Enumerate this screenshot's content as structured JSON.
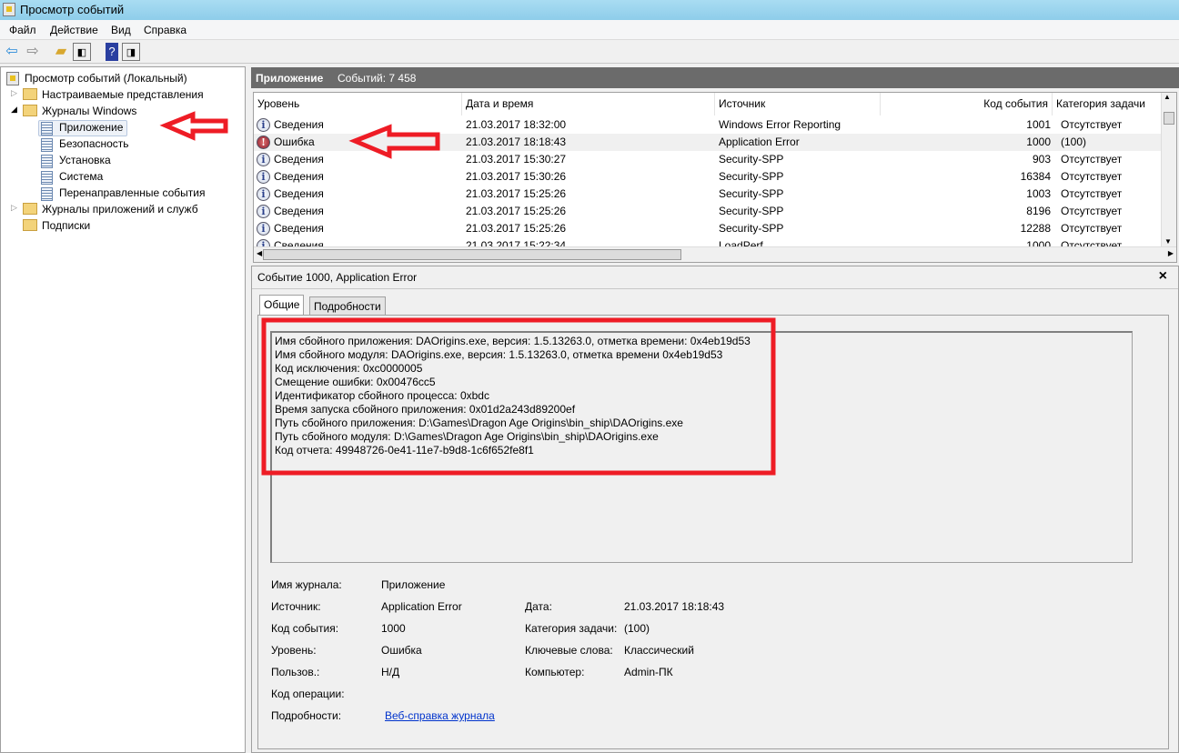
{
  "window": {
    "title": "Просмотр событий"
  },
  "menu": [
    "Файл",
    "Действие",
    "Вид",
    "Справка"
  ],
  "tree": {
    "root": "Просмотр событий (Локальный)",
    "custom_views": "Настраиваемые представления",
    "windows_logs": "Журналы Windows",
    "logs": [
      "Приложение",
      "Безопасность",
      "Установка",
      "Система",
      "Перенаправленные события"
    ],
    "app_logs": "Журналы приложений и служб",
    "subscriptions": "Подписки"
  },
  "header": {
    "title": "Приложение",
    "count": "Событий: 7 458"
  },
  "columns": [
    "Уровень",
    "Дата и время",
    "Источник",
    "Код события",
    "Категория задачи"
  ],
  "rows": [
    {
      "level": "Сведения",
      "type": "info",
      "date": "21.03.2017 18:32:00",
      "source": "Windows Error Reporting",
      "id": "1001",
      "cat": "Отсутствует"
    },
    {
      "level": "Ошибка",
      "type": "error",
      "date": "21.03.2017 18:18:43",
      "source": "Application Error",
      "id": "1000",
      "cat": "(100)"
    },
    {
      "level": "Сведения",
      "type": "info",
      "date": "21.03.2017 15:30:27",
      "source": "Security-SPP",
      "id": "903",
      "cat": "Отсутствует"
    },
    {
      "level": "Сведения",
      "type": "info",
      "date": "21.03.2017 15:30:26",
      "source": "Security-SPP",
      "id": "16384",
      "cat": "Отсутствует"
    },
    {
      "level": "Сведения",
      "type": "info",
      "date": "21.03.2017 15:25:26",
      "source": "Security-SPP",
      "id": "1003",
      "cat": "Отсутствует"
    },
    {
      "level": "Сведения",
      "type": "info",
      "date": "21.03.2017 15:25:26",
      "source": "Security-SPP",
      "id": "8196",
      "cat": "Отсутствует"
    },
    {
      "level": "Сведения",
      "type": "info",
      "date": "21.03.2017 15:25:26",
      "source": "Security-SPP",
      "id": "12288",
      "cat": "Отсутствует"
    },
    {
      "level": "Сведения",
      "type": "info",
      "date": "21.03.2017 15:22:34",
      "source": "LoadPerf",
      "id": "1000",
      "cat": "Отсутствует"
    }
  ],
  "detail": {
    "title": "Событие 1000, Application Error",
    "close": "×",
    "tabs": [
      "Общие",
      "Подробности"
    ],
    "lines": [
      "Имя сбойного приложения: DAOrigins.exe, версия: 1.5.13263.0, отметка времени: 0x4eb19d53",
      "Имя сбойного модуля: DAOrigins.exe, версия: 1.5.13263.0, отметка времени 0x4eb19d53",
      "Код исключения: 0xc0000005",
      "Смещение ошибки: 0x00476cc5",
      "Идентификатор сбойного процесса: 0xbdc",
      "Время запуска сбойного приложения: 0x01d2a243d89200ef",
      "Путь сбойного приложения: D:\\Games\\Dragon Age Origins\\bin_ship\\DAOrigins.exe",
      "Путь сбойного модуля: D:\\Games\\Dragon Age Origins\\bin_ship\\DAOrigins.exe",
      "Код отчета: 49948726-0e41-11e7-b9d8-1c6f652fe8f1"
    ],
    "fields": {
      "log_label": "Имя журнала:",
      "log": "Приложение",
      "source_label": "Источник:",
      "source": "Application Error",
      "date_label": "Дата:",
      "date": "21.03.2017 18:18:43",
      "id_label": "Код события:",
      "id": "1000",
      "cat_label": "Категория задачи:",
      "cat": "(100)",
      "level_label": "Уровень:",
      "level": "Ошибка",
      "kw_label": "Ключевые слова:",
      "kw": "Классический",
      "user_label": "Пользов.:",
      "user": "Н/Д",
      "pc_label": "Компьютер:",
      "pc": "Admin-ПК",
      "op_label": "Код операции:",
      "more_label": "Подробности:",
      "link": "Веб-справка журнала"
    }
  },
  "colors": {
    "annotation": "#ee1c25",
    "header_bg": "#6b6b6b"
  }
}
